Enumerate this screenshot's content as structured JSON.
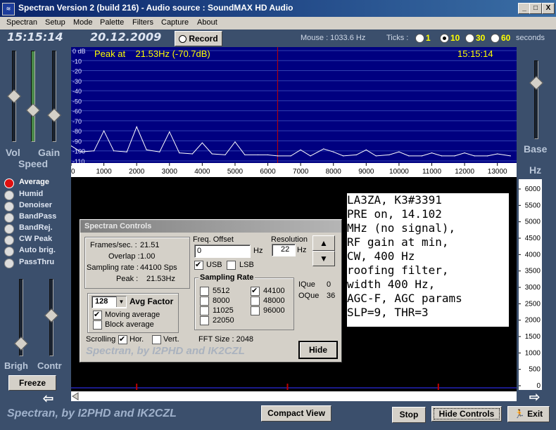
{
  "window": {
    "title": "Spectran Version 2 (build 216) - Audio source  :  SoundMAX HD Audio",
    "icon": "spectrum-app-icon",
    "buttons": {
      "minimize": "_",
      "maximize": "□",
      "close": "X"
    }
  },
  "menu": [
    "Spectran",
    "Setup",
    "Mode",
    "Palette",
    "Filters",
    "Capture",
    "About"
  ],
  "toolbar": {
    "clock": "15:15:14",
    "date": "20.12.2009",
    "record_label": "Record",
    "mouse_readout": "Mouse : 1033.6 Hz",
    "ticks_label": "Ticks :",
    "tick_options": [
      "1",
      "10",
      "30",
      "60"
    ],
    "tick_selected": "10",
    "seconds_label": "seconds"
  },
  "spectrum": {
    "peak_label": "Peak at    21.53Hz (-70.7dB)",
    "time": "15:15:14",
    "db_ticks": [
      "0 dB",
      "-10",
      "-20",
      "-30",
      "-40",
      "-50",
      "-60",
      "-70",
      "-80",
      "-90",
      "-100",
      "-110"
    ],
    "freq_ticks": [
      "0",
      "1000",
      "2000",
      "3000",
      "4000",
      "5000",
      "6000",
      "7000",
      "8000",
      "9000",
      "10000",
      "11000",
      "12000",
      "13000"
    ],
    "hz_label": "Hz",
    "base_label": "Base",
    "marker_hz": 6300
  },
  "chart_data": {
    "type": "line",
    "title": "",
    "xlabel": "Hz",
    "ylabel": "dB",
    "xlim": [
      0,
      13500
    ],
    "ylim": [
      -110,
      0
    ],
    "x": [
      0,
      300,
      700,
      1000,
      1300,
      1700,
      2000,
      2300,
      2700,
      3000,
      3300,
      3700,
      4000,
      4300,
      4700,
      5000,
      5300,
      5700,
      6000,
      6300,
      6700,
      7000,
      7300,
      7700,
      8000,
      8300,
      8700,
      9000,
      9300,
      9700,
      10000,
      10300,
      10700,
      11000,
      11300,
      11700,
      12000,
      12300,
      12700,
      13000,
      13400
    ],
    "y": [
      -95,
      -101,
      -100,
      -80,
      -100,
      -101,
      -76,
      -99,
      -101,
      -81,
      -102,
      -103,
      -92,
      -103,
      -104,
      -91,
      -104,
      -104,
      -104,
      -105,
      -105,
      -99,
      -105,
      -98,
      -101,
      -105,
      -104,
      -99,
      -105,
      -104,
      -101,
      -105,
      -105,
      -102,
      -105,
      -105,
      -102,
      -105,
      -105,
      -103,
      -105
    ]
  },
  "waterfall": {
    "scale_ticks": [
      "6000",
      "5500",
      "5000",
      "4500",
      "4000",
      "3500",
      "3000",
      "2500",
      "2000",
      "1500",
      "1000",
      "500",
      "0"
    ]
  },
  "left_panel": {
    "vol_label": "Vol",
    "gain_label": "Gain",
    "speed_label": "Speed",
    "vol_level": 0.62,
    "speed_level": 0.45,
    "gain_level": 0.58,
    "modes": [
      "Average",
      "Humid",
      "Denoiser",
      "BandPass",
      "BandRej.",
      "CW Peak",
      "Auto brig.",
      "PassThru"
    ],
    "mode_selected": "Average",
    "brigh_label": "Brigh",
    "contr_label": "Contr",
    "brigh_level": 0.15,
    "contr_level": 0.55,
    "freeze_label": "Freeze"
  },
  "controls": {
    "title": "Spectran Controls",
    "info": {
      "frames_label": "Frames/sec. :",
      "frames_value": "21.51",
      "overlap_label": "Overlap :",
      "overlap_value": "1.00",
      "sampling_label": "Sampling rate :",
      "sampling_value": "44100 Sps",
      "peak_label": "Peak :",
      "peak_value": "21.53Hz"
    },
    "avg_factor_value": "128",
    "avg_factor_label": "Avg Factor",
    "moving_average_label": "Moving average",
    "block_average_label": "Block average",
    "scrolling_label": "Scrolling",
    "hor_label": "Hor.",
    "vert_label": "Vert.",
    "freq_offset_label": "Freq. Offset",
    "freq_offset_value": "0",
    "hz_unit": "Hz",
    "resolution_label": "Resolution",
    "resolution_value": "22",
    "usb_label": "USB",
    "lsb_label": "LSB",
    "sampling_rate_title": "Sampling Rate",
    "rates_left": [
      "5512",
      "8000",
      "11025",
      "22050"
    ],
    "rates_right": [
      "44100",
      "48000",
      "96000"
    ],
    "rate_selected": "44100",
    "ique_label": "IQue",
    "ique_value": "0",
    "oque_label": "OQue",
    "oque_value": "36",
    "fft_size": "FFT Size : 2048",
    "brand": "Spectran, by I2PHD and IK2CZL",
    "hide_label": "Hide"
  },
  "note_text": "LA3ZA, K3#3391\nPRE on, 14.102\nMHz (no signal),\nRF gain at min,\nCW, 400 Hz\nroofing filter,\nwidth 400 Hz,\nAGC-F, AGC params\nSLP=9, THR=3",
  "bottom": {
    "brand": "Spectran, by I2PHD and IK2CZL",
    "compact_view": "Compact View",
    "stop": "Stop",
    "hide_controls": "Hide Controls",
    "exit": "Exit"
  },
  "colors": {
    "spectrum_bg": "#000080",
    "trace": "#ffffff",
    "marker": "#c00000",
    "peak_text": "#ffff00"
  }
}
